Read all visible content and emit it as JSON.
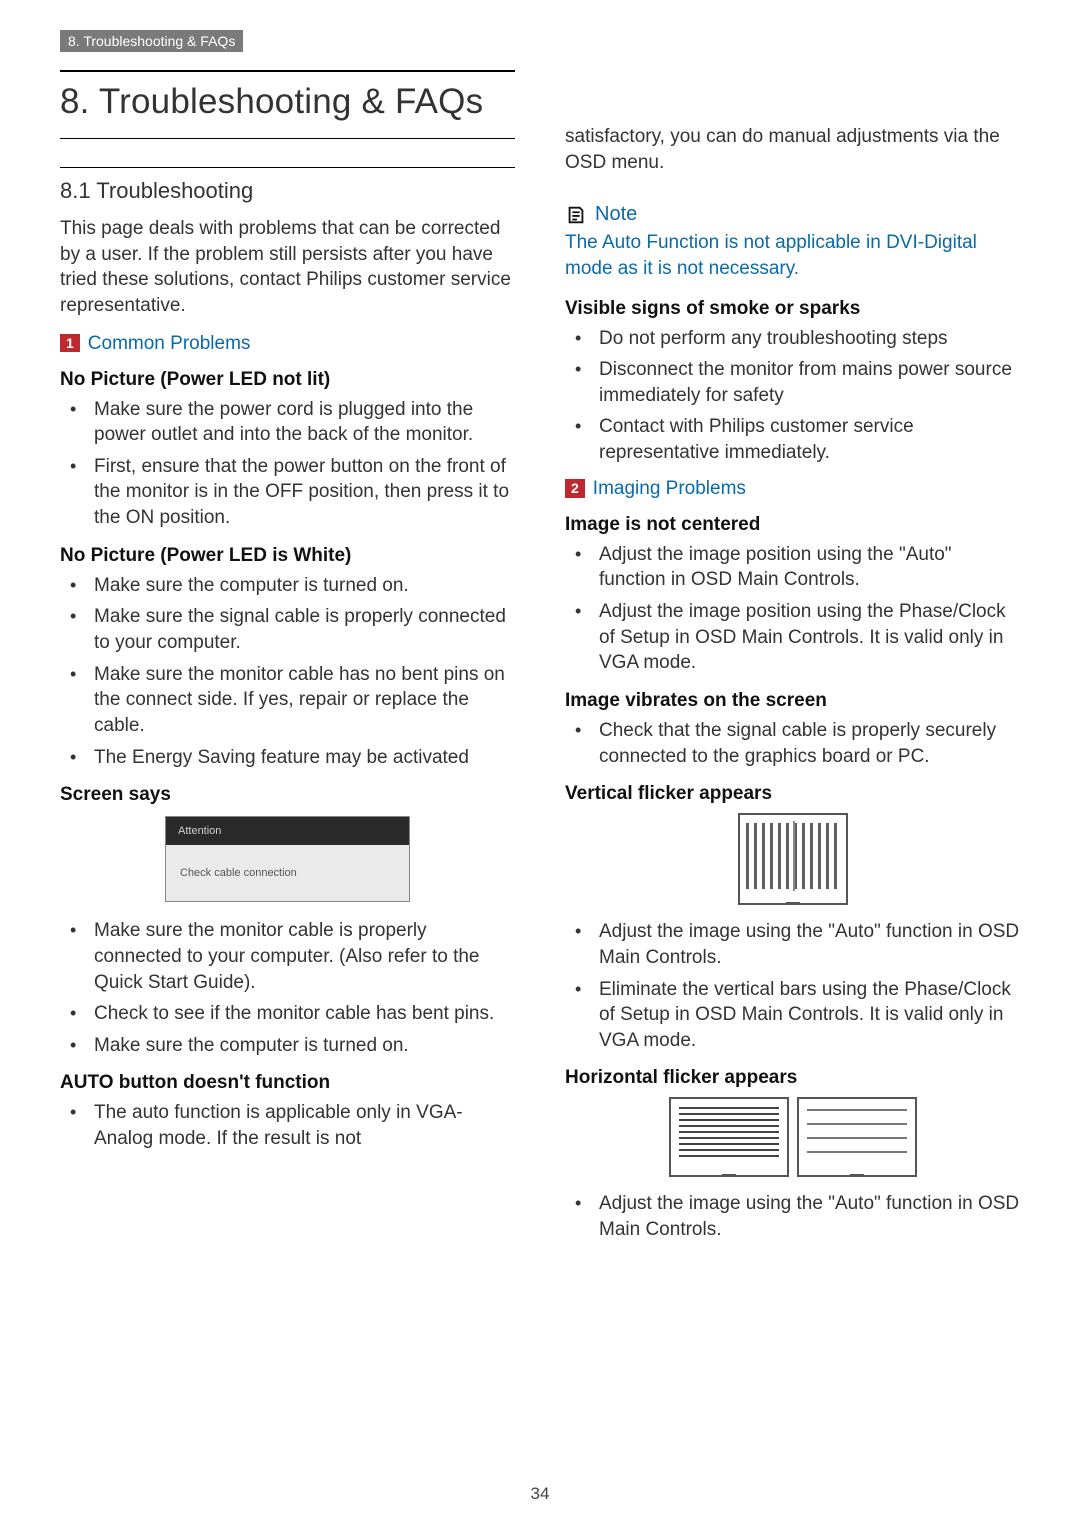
{
  "header_bar": "8. Troubleshooting & FAQs",
  "chapter_title": "8.   Troubleshooting & FAQs",
  "section_title": "8.1  Troubleshooting",
  "intro": "This page deals with problems that can be corrected by a user. If the problem still persists after you have tried these solutions, contact Philips customer service representative.",
  "box1_num": "1",
  "box1_title": "Common Problems",
  "h_no_pic_led_off": "No Picture (Power LED not lit)",
  "li_led_off_1": "Make sure the power cord is plugged into the power outlet and into the back of the monitor.",
  "li_led_off_2": "First, ensure that the power button on the front of the monitor is in the OFF position, then press it to the ON position.",
  "h_no_pic_led_white": "No Picture (Power LED is White)",
  "li_white_1": "Make sure the computer is turned on.",
  "li_white_2": "Make sure the signal cable is properly connected to your computer.",
  "li_white_3": "Make sure the monitor cable has no bent pins on the connect side. If yes, repair or replace the cable.",
  "li_white_4": "The Energy Saving feature may be activated",
  "h_screen_says": "Screen says",
  "dialog_title": "Attention",
  "dialog_body": "Check cable connection",
  "li_screen_1": "Make sure the monitor cable is properly connected to your computer. (Also refer to the Quick Start Guide).",
  "li_screen_2": "Check to see if the monitor cable has bent pins.",
  "li_screen_3": "Make sure the computer is turned on.",
  "h_auto_btn": "AUTO button doesn't function",
  "li_auto_1": "The auto function is applicable only in VGA-Analog mode.  If the result is not",
  "auto_cont": "satisfactory, you can do manual adjustments via the OSD menu.",
  "note_title": "Note",
  "note_body": "The Auto Function is not applicable in DVI-Digital mode as it is not necessary.",
  "h_smoke": "Visible signs of smoke or sparks",
  "li_smoke_1": "Do not perform any troubleshooting steps",
  "li_smoke_2": "Disconnect the monitor from mains power source immediately for safety",
  "li_smoke_3": "Contact with Philips customer service representative immediately.",
  "box2_num": "2",
  "box2_title": "Imaging Problems",
  "h_center": "Image is not centered",
  "li_center_1": "Adjust the image position using the \"Auto\" function in OSD Main Controls.",
  "li_center_2": "Adjust the image position using the Phase/Clock of Setup in OSD Main Controls.  It is valid only in VGA mode.",
  "h_vibrate": "Image vibrates on the screen",
  "li_vibrate_1": "Check that the signal cable is properly securely connected to the graphics board or PC.",
  "h_vflick": "Vertical flicker appears",
  "li_vflick_1": "Adjust the image using the \"Auto\" function in OSD Main Controls.",
  "li_vflick_2": "Eliminate the vertical bars using the Phase/Clock of Setup in OSD Main Controls. It is valid only in VGA mode.",
  "h_hflick": "Horizontal flicker appears",
  "li_hflick_1": "Adjust the image using the \"Auto\" function in OSD Main Controls.",
  "page_number": "34"
}
